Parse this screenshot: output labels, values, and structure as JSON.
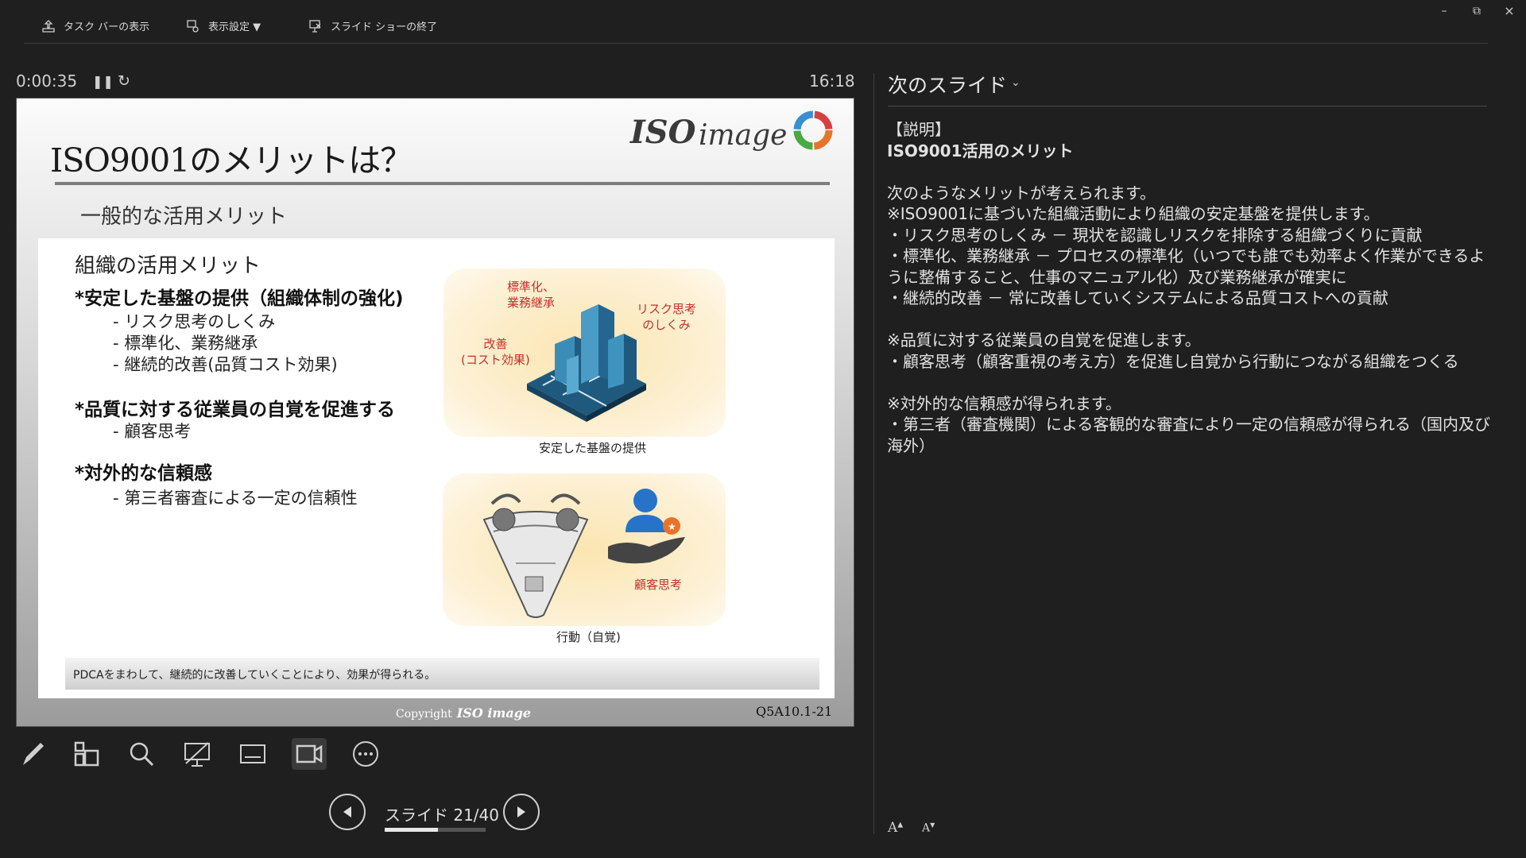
{
  "toolbar": {
    "show_taskbar": "タスク バーの表示",
    "display_settings": "表示設定 ▼",
    "end_slideshow": "スライド ショーの終了"
  },
  "window_controls": {
    "minimize": "–",
    "restore": "⧉",
    "close": "×"
  },
  "presenter": {
    "elapsed_time": "0:00:35",
    "clock": "16:18"
  },
  "slide": {
    "title": "ISO9001のメリットは？",
    "subtitle": "一般的な活用メリット",
    "logo_text": "ISO image",
    "panel_heading": "組織の活用メリット",
    "points": [
      {
        "title": "*安定した基盤の提供（組織体制の強化)",
        "subs": [
          "- リスク思考のしくみ",
          "- 標準化、業務継承",
          "- 継続的改善(品質コスト効果)"
        ]
      },
      {
        "title": "*品質に対する従業員の自覚を促進する",
        "subs": [
          "- 顧客思考"
        ]
      },
      {
        "title": "*対外的な信頼感",
        "subs": [
          "- 第三者審査による一定の信頼性"
        ]
      }
    ],
    "image1": {
      "label_standardization": "標準化、\n業務継承",
      "label_risk": "リスク思考\nのしくみ",
      "label_improvement": "改善\n(コスト効果)",
      "caption": "安定した基盤の提供"
    },
    "image2": {
      "label_customer": "顧客思考",
      "caption": "行動（自覚)"
    },
    "footer_text": "PDCAをまわして、継続的に改善していくことにより、効果が得られる。",
    "copyright_label": "Copyright",
    "copyright_brand": "ISO image",
    "slide_code": "Q5A10.1-21"
  },
  "navigation": {
    "counter": "スライド 21/40",
    "current": 21,
    "total": 40,
    "progress": 0.525
  },
  "next_slide": {
    "heading": "次のスライド",
    "notes": [
      "【説明】",
      "ISO9001活用のメリット",
      "",
      "次のようなメリットが考えられます。",
      "※ISO9001に基づいた組織活動により組織の安定基盤を提供します。",
      "・リスク思考のしくみ － 現状を認識しリスクを排除する組織づくりに貢献",
      "・標準化、業務継承 － プロセスの標準化（いつでも誰でも効率よく作業ができるように整備すること、仕事のマニュアル化）及び業務継承が確実に",
      "・継続的改善 － 常に改善していくシステムによる品質コストへの貢献",
      "",
      "※品質に対する従業員の自覚を促進します。",
      "・顧客思考（顧客重視の考え方）を促進し自覚から行動につながる組織をつくる",
      "",
      "※対外的な信頼感が得られます。",
      "・第三者（審査機関）による客観的な審査により一定の信頼感が得られる（国内及び海外）"
    ],
    "increase_font": "A",
    "decrease_font": "A"
  },
  "colors": {
    "background": "#1f1f1f",
    "accent_red": "#c0302c",
    "image_bg": "#fbe5b1",
    "building_blue": "#2f7ea8"
  },
  "icons": [
    "upload-icon",
    "display-settings-icon",
    "end-show-icon",
    "pause-icon",
    "restart-icon",
    "pen-icon",
    "all-slides-icon",
    "zoom-icon",
    "black-screen-icon",
    "subtitles-icon",
    "camera-icon",
    "more-icon",
    "prev-arrow-icon",
    "next-arrow-icon"
  ]
}
